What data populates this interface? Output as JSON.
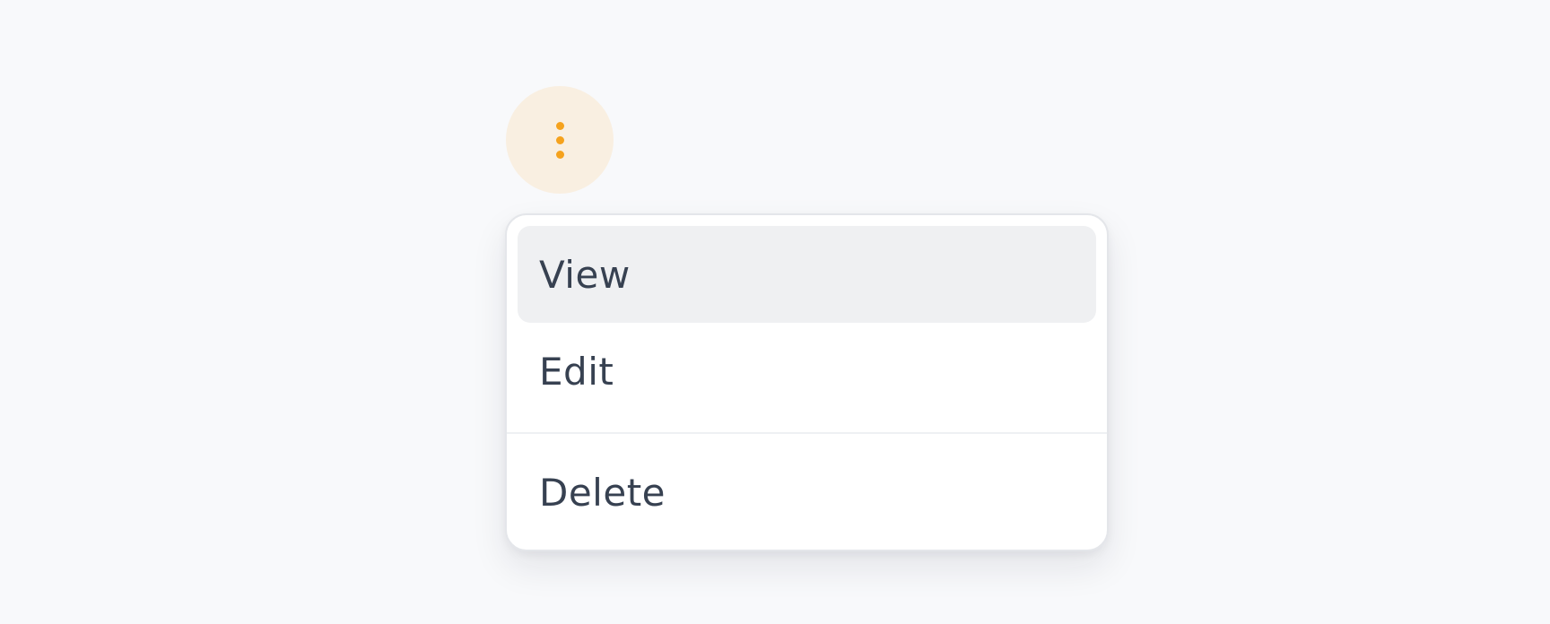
{
  "trigger": {
    "icon": "dots-vertical-icon",
    "accent_color": "#f5a21d",
    "background_color": "#f9efe1"
  },
  "menu": {
    "items": [
      {
        "label": "View",
        "highlighted": true
      },
      {
        "label": "Edit",
        "highlighted": false
      }
    ],
    "danger_items": [
      {
        "label": "Delete"
      }
    ]
  },
  "colors": {
    "page_background": "#f8f9fb",
    "menu_text": "#374151",
    "highlight_background": "#eff0f2"
  }
}
